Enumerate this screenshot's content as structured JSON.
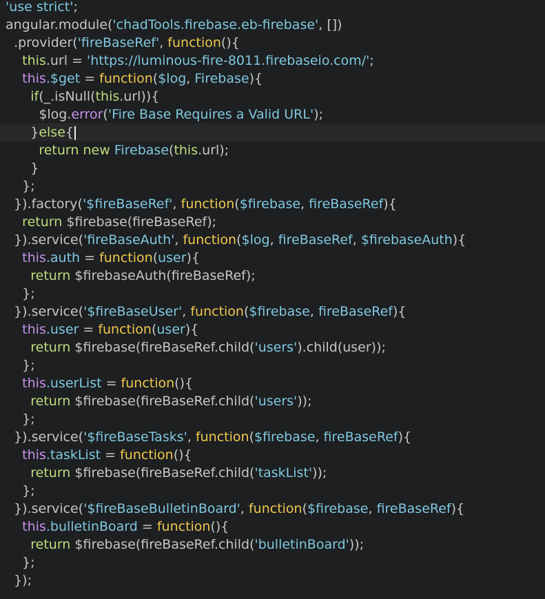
{
  "editor": {
    "theme_colors": {
      "background": "#1d1f21",
      "string": "#80c8e0",
      "keyword": "#c3da7d",
      "function": "#f0c94f",
      "this": "#c792ea",
      "plain": "#c5c8c6"
    },
    "active_line": 7,
    "lines": [
      [
        [
          "str",
          "'use strict'"
        ],
        [
          "def",
          ";"
        ]
      ],
      [
        [
          "def",
          "angular.module("
        ],
        [
          "str",
          "'chadTools.firebase.eb-firebase'"
        ],
        [
          "def",
          ", [])"
        ]
      ],
      [
        [
          "def",
          "  .provider("
        ],
        [
          "str",
          "'fireBaseRef'"
        ],
        [
          "def",
          ", "
        ],
        [
          "fn",
          "function"
        ],
        [
          "def",
          "(){"
        ]
      ],
      [
        [
          "def",
          "    "
        ],
        [
          "kw",
          "this"
        ],
        [
          "def",
          ".url = "
        ],
        [
          "str",
          "'https://luminous-fire-8011.firebaseio.com/'"
        ],
        [
          "def",
          ";"
        ]
      ],
      [
        [
          "def",
          "    "
        ],
        [
          "this",
          "this"
        ],
        [
          "str",
          ".$get"
        ],
        [
          "def",
          " = "
        ],
        [
          "fn",
          "function"
        ],
        [
          "def",
          "("
        ],
        [
          "str",
          "$log"
        ],
        [
          "def",
          ", "
        ],
        [
          "str",
          "Firebase"
        ],
        [
          "def",
          "){"
        ]
      ],
      [
        [
          "def",
          "      "
        ],
        [
          "kw",
          "if"
        ],
        [
          "def",
          "(_.isNull("
        ],
        [
          "kw",
          "this"
        ],
        [
          "def",
          ".url)){"
        ]
      ],
      [
        [
          "def",
          "        $log."
        ],
        [
          "this",
          "error"
        ],
        [
          "def",
          "("
        ],
        [
          "str",
          "'Fire Base Requires a Valid URL'"
        ],
        [
          "def",
          ");"
        ]
      ],
      [
        [
          "def",
          "      }"
        ],
        [
          "kw",
          "else"
        ],
        [
          "def",
          "{"
        ],
        [
          "caret",
          ""
        ]
      ],
      [
        [
          "def",
          "        "
        ],
        [
          "kw",
          "return"
        ],
        [
          "def",
          " "
        ],
        [
          "kw",
          "new"
        ],
        [
          "def",
          " "
        ],
        [
          "str",
          "Firebase"
        ],
        [
          "def",
          "("
        ],
        [
          "kw",
          "this"
        ],
        [
          "def",
          ".url);"
        ]
      ],
      [
        [
          "def",
          "      }"
        ]
      ],
      [
        [
          "def",
          "    };"
        ]
      ],
      [
        [
          "def",
          "  })."
        ],
        [
          "def",
          "factory("
        ],
        [
          "str",
          "'$fireBaseRef'"
        ],
        [
          "def",
          ", "
        ],
        [
          "fn",
          "function"
        ],
        [
          "def",
          "("
        ],
        [
          "str",
          "$firebase"
        ],
        [
          "def",
          ", "
        ],
        [
          "str",
          "fireBaseRef"
        ],
        [
          "def",
          "){"
        ]
      ],
      [
        [
          "def",
          "    "
        ],
        [
          "kw",
          "return"
        ],
        [
          "def",
          " $firebase(fireBaseRef);"
        ]
      ],
      [
        [
          "def",
          "  }).service("
        ],
        [
          "str",
          "'fireBaseAuth'"
        ],
        [
          "def",
          ", "
        ],
        [
          "fn",
          "function"
        ],
        [
          "def",
          "("
        ],
        [
          "str",
          "$log"
        ],
        [
          "def",
          ", "
        ],
        [
          "str",
          "fireBaseRef"
        ],
        [
          "def",
          ", "
        ],
        [
          "str",
          "$firebaseAuth"
        ],
        [
          "def",
          "){"
        ]
      ],
      [
        [
          "def",
          "    "
        ],
        [
          "this",
          "this"
        ],
        [
          "str",
          ".auth"
        ],
        [
          "def",
          " = "
        ],
        [
          "fn",
          "function"
        ],
        [
          "def",
          "("
        ],
        [
          "str",
          "user"
        ],
        [
          "def",
          "){"
        ]
      ],
      [
        [
          "def",
          "      "
        ],
        [
          "kw",
          "return"
        ],
        [
          "def",
          " $firebaseAuth(fireBaseRef);"
        ]
      ],
      [
        [
          "def",
          "    };"
        ]
      ],
      [
        [
          "def",
          "  }).service("
        ],
        [
          "str",
          "'$fireBaseUser'"
        ],
        [
          "def",
          ", "
        ],
        [
          "fn",
          "function"
        ],
        [
          "def",
          "("
        ],
        [
          "str",
          "$firebase"
        ],
        [
          "def",
          ", "
        ],
        [
          "str",
          "fireBaseRef"
        ],
        [
          "def",
          "){"
        ]
      ],
      [
        [
          "def",
          "    "
        ],
        [
          "this",
          "this"
        ],
        [
          "str",
          ".user"
        ],
        [
          "def",
          " = "
        ],
        [
          "fn",
          "function"
        ],
        [
          "def",
          "("
        ],
        [
          "str",
          "user"
        ],
        [
          "def",
          "){"
        ]
      ],
      [
        [
          "def",
          "      "
        ],
        [
          "kw",
          "return"
        ],
        [
          "def",
          " $firebase(fireBaseRef.child("
        ],
        [
          "str",
          "'users'"
        ],
        [
          "def",
          ").child(user));"
        ]
      ],
      [
        [
          "def",
          "    };"
        ]
      ],
      [
        [
          "def",
          "    "
        ],
        [
          "this",
          "this"
        ],
        [
          "str",
          ".userList"
        ],
        [
          "def",
          " = "
        ],
        [
          "fn",
          "function"
        ],
        [
          "def",
          "(){"
        ]
      ],
      [
        [
          "def",
          "      "
        ],
        [
          "kw",
          "return"
        ],
        [
          "def",
          " $firebase(fireBaseRef.child("
        ],
        [
          "str",
          "'users'"
        ],
        [
          "def",
          "));"
        ]
      ],
      [
        [
          "def",
          "    };"
        ]
      ],
      [
        [
          "def",
          "  }).service("
        ],
        [
          "str",
          "'$fireBaseTasks'"
        ],
        [
          "def",
          ", "
        ],
        [
          "fn",
          "function"
        ],
        [
          "def",
          "("
        ],
        [
          "str",
          "$firebase"
        ],
        [
          "def",
          ", "
        ],
        [
          "str",
          "fireBaseRef"
        ],
        [
          "def",
          "){"
        ]
      ],
      [
        [
          "def",
          "    "
        ],
        [
          "this",
          "this"
        ],
        [
          "str",
          ".taskList"
        ],
        [
          "def",
          " = "
        ],
        [
          "fn",
          "function"
        ],
        [
          "def",
          "(){"
        ]
      ],
      [
        [
          "def",
          "      "
        ],
        [
          "kw",
          "return"
        ],
        [
          "def",
          " $firebase(fireBaseRef.child("
        ],
        [
          "str",
          "'taskList'"
        ],
        [
          "def",
          "));"
        ]
      ],
      [
        [
          "def",
          "    };"
        ]
      ],
      [
        [
          "def",
          "  }).service("
        ],
        [
          "str",
          "'$fireBaseBulletinBoard'"
        ],
        [
          "def",
          ", "
        ],
        [
          "fn",
          "function"
        ],
        [
          "def",
          "("
        ],
        [
          "str",
          "$firebase"
        ],
        [
          "def",
          ", "
        ],
        [
          "str",
          "fireBaseRef"
        ],
        [
          "def",
          "){"
        ]
      ],
      [
        [
          "def",
          "    "
        ],
        [
          "this",
          "this"
        ],
        [
          "str",
          ".bulletinBoard"
        ],
        [
          "def",
          " = "
        ],
        [
          "fn",
          "function"
        ],
        [
          "def",
          "(){"
        ]
      ],
      [
        [
          "def",
          "      "
        ],
        [
          "kw",
          "return"
        ],
        [
          "def",
          " $firebase(fireBaseRef.child("
        ],
        [
          "str",
          "'bulletinBoard'"
        ],
        [
          "def",
          "));"
        ]
      ],
      [
        [
          "def",
          "    };"
        ]
      ],
      [
        [
          "def",
          "  });"
        ]
      ]
    ]
  }
}
